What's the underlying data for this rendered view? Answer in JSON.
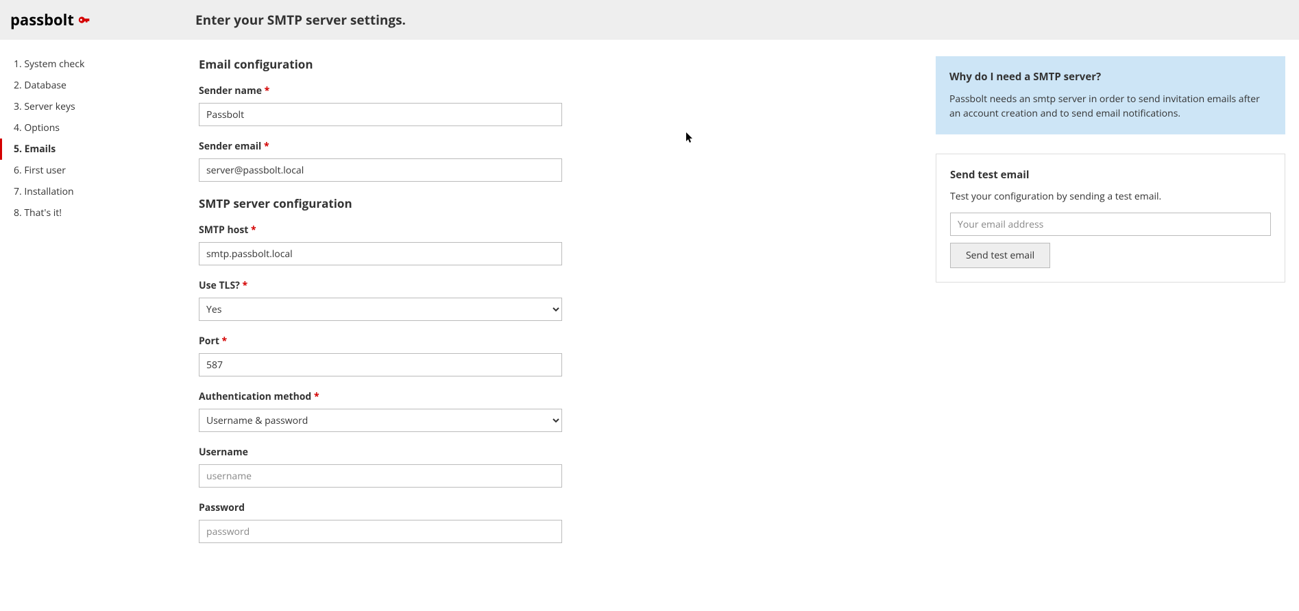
{
  "logo_text": "passbolt",
  "page_title": "Enter your SMTP server settings.",
  "sidebar": {
    "steps": [
      "1. System check",
      "2. Database",
      "3. Server keys",
      "4. Options",
      "5. Emails",
      "6. First user",
      "7. Installation",
      "8. That's it!"
    ],
    "active_index": 4
  },
  "form": {
    "section_email": "Email configuration",
    "sender_name_label": "Sender name",
    "sender_name_value": "Passbolt",
    "sender_email_label": "Sender email",
    "sender_email_value": "server@passbolt.local",
    "section_smtp": "SMTP server configuration",
    "smtp_host_label": "SMTP host",
    "smtp_host_value": "smtp.passbolt.local",
    "tls_label": "Use TLS?",
    "tls_value": "Yes",
    "port_label": "Port",
    "port_value": "587",
    "auth_label": "Authentication method",
    "auth_value": "Username & password",
    "username_label": "Username",
    "username_placeholder": "username",
    "password_label": "Password",
    "password_placeholder": "password"
  },
  "info": {
    "title": "Why do I need a SMTP server?",
    "body": "Passbolt needs an smtp server in order to send invitation emails after an account creation and to send email notifications."
  },
  "test": {
    "title": "Send test email",
    "body": "Test your configuration by sending a test email.",
    "placeholder": "Your email address",
    "button": "Send test email"
  }
}
